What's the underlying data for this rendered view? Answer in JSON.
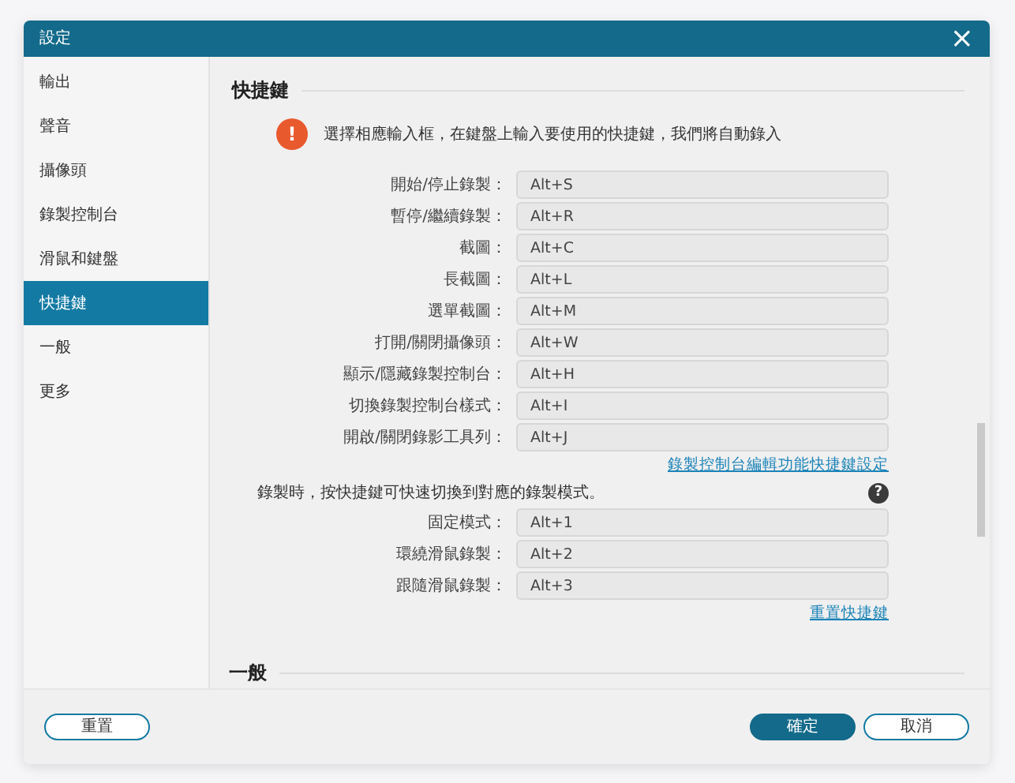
{
  "window": {
    "title": "設定",
    "close": "×"
  },
  "sidebar": {
    "items": [
      {
        "label": "輸出",
        "selected": false
      },
      {
        "label": "聲音",
        "selected": false
      },
      {
        "label": "攝像頭",
        "selected": false
      },
      {
        "label": "錄製控制台",
        "selected": false
      },
      {
        "label": "滑鼠和鍵盤",
        "selected": false
      },
      {
        "label": "快捷鍵",
        "selected": true
      },
      {
        "label": "一般",
        "selected": false
      },
      {
        "label": "更多",
        "selected": false
      }
    ]
  },
  "content": {
    "section_title": "快捷鍵",
    "notice": "選擇相應輸入框，在鍵盤上輸入要使用的快捷鍵，我們將自動錄入",
    "notice_icon": "!",
    "shortcuts": [
      {
        "label": "開始/停止錄製：",
        "value": "Alt+S"
      },
      {
        "label": "暫停/繼續錄製：",
        "value": "Alt+R"
      },
      {
        "label": "截圖：",
        "value": "Alt+C"
      },
      {
        "label": "長截圖：",
        "value": "Alt+L"
      },
      {
        "label": "選單截圖：",
        "value": "Alt+M"
      },
      {
        "label": "打開/關閉攝像頭：",
        "value": "Alt+W"
      },
      {
        "label": "顯示/隱藏錄製控制台：",
        "value": "Alt+H"
      },
      {
        "label": "切換錄製控制台樣式：",
        "value": "Alt+I"
      },
      {
        "label": "開啟/關閉錄影工具列：",
        "value": "Alt+J"
      }
    ],
    "console_link": "錄製控制台編輯功能快捷鍵設定",
    "mode_note": "錄製時，按快捷鍵可快速切換到對應的錄製模式。",
    "help_icon": "?",
    "mode_shortcuts": [
      {
        "label": "固定模式：",
        "value": "Alt+1"
      },
      {
        "label": "環繞滑鼠錄製：",
        "value": "Alt+2"
      },
      {
        "label": "跟隨滑鼠錄製：",
        "value": "Alt+3"
      }
    ],
    "reset_link": "重置快捷鍵",
    "next_section_title": "一般"
  },
  "footer": {
    "reset": "重置",
    "ok": "確定",
    "cancel": "取消"
  }
}
